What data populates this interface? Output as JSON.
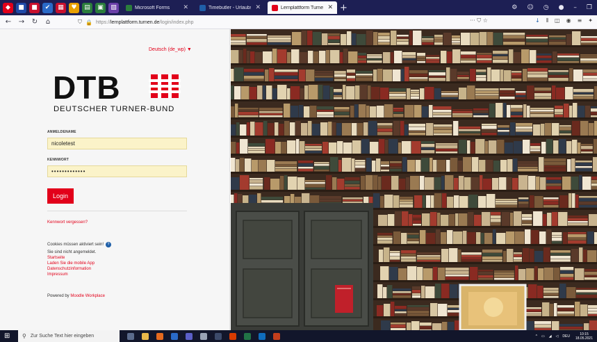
{
  "browser": {
    "pinned_tabs": [
      {
        "icon": "shield-icon",
        "color": "#e2001a"
      },
      {
        "icon": "app-icon",
        "color": "#1f4aa8"
      },
      {
        "icon": "app-icon",
        "color": "#c8102e"
      },
      {
        "icon": "check-icon",
        "color": "#2a6ac8"
      },
      {
        "icon": "grid-icon",
        "color": "#c8102e"
      },
      {
        "icon": "heart-icon",
        "color": "#e8a000"
      },
      {
        "icon": "sheet-icon",
        "color": "#2b7d3c"
      },
      {
        "icon": "doc-icon",
        "color": "#2b7d3c"
      },
      {
        "icon": "image-icon",
        "color": "#6a3fa8"
      }
    ],
    "tabs": [
      {
        "title": "Microsoft Forms",
        "color": "#2b7d3c",
        "active": false
      },
      {
        "title": "Timebutler - Urlaubsverwaltung",
        "color": "#1f5fa8",
        "active": false
      },
      {
        "title": "Lernplattform Turnen: Hier kön",
        "color": "#e2001a",
        "active": true
      }
    ],
    "url_prefix": "https://",
    "url_host": "lernplattform.turnen.de",
    "url_path": "/login/index.php"
  },
  "login": {
    "language": "Deutsch (de_wp) ▼",
    "logo_text": "DTB",
    "logo_subtitle": "DEUTSCHER TURNER-BUND",
    "username_label": "ANMELDENAME",
    "username_value": "nicoletest",
    "password_label": "KENNWORT",
    "password_value": "•••••••••••••",
    "login_button": "Login",
    "forgot_password": "Kennwort vergessen?",
    "cookies_notice": "Cookies müssen aktiviert sein!",
    "not_logged_in": "Sie sind nicht angemeldet.",
    "links": [
      "Startseite",
      "Laden Sie die mobile App",
      "Datenschutzinformation",
      "Impressum"
    ],
    "powered_by": "Powered by",
    "powered_by_link": "Moodle Workplace"
  },
  "taskbar": {
    "search_placeholder": "Zur Suche Text hier eingeben",
    "language": "DEU",
    "time": "10:15",
    "date": "18.05.2021"
  },
  "colors": {
    "brand_red": "#e2001a",
    "titlebar": "#1d1f54",
    "taskbar": "#12162b",
    "field_bg": "#fbf3c9"
  }
}
